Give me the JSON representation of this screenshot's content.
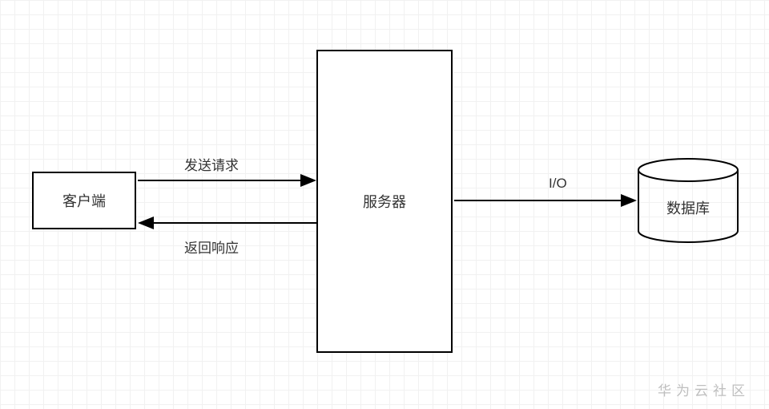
{
  "nodes": {
    "client": "客户端",
    "server": "服务器",
    "database": "数据库"
  },
  "edges": {
    "request": "发送请求",
    "response": "返回响应",
    "io": "I/O"
  },
  "watermark": "华为云社区"
}
